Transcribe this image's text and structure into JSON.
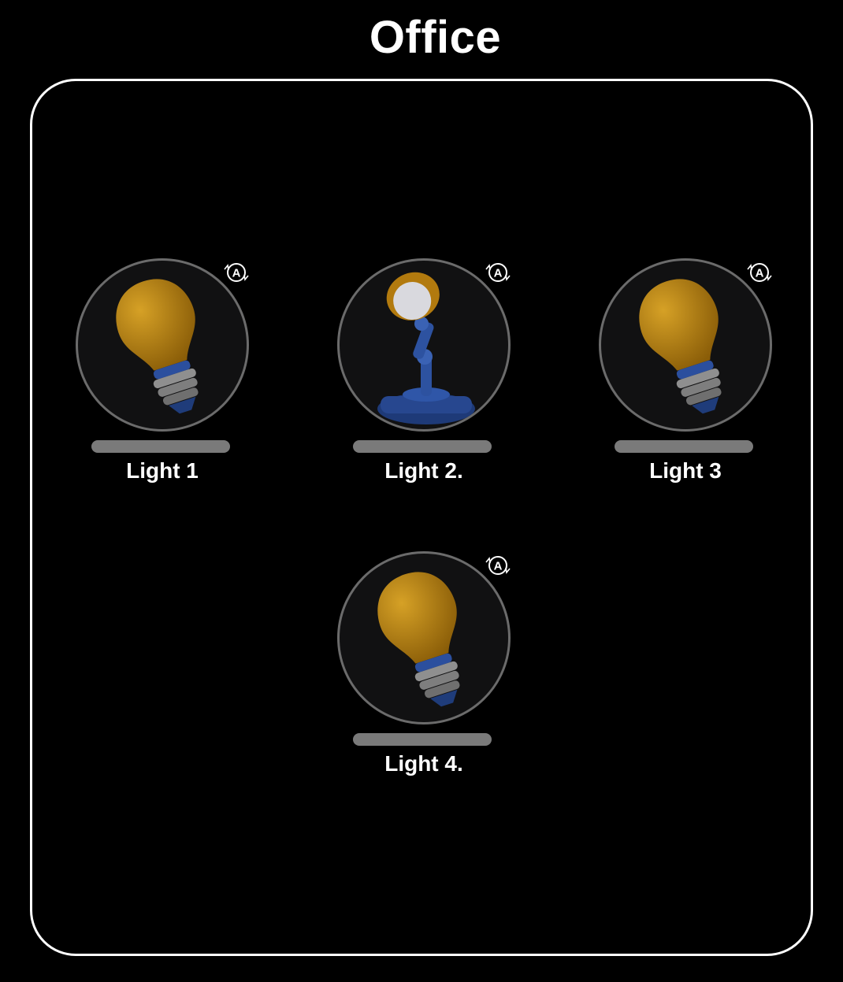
{
  "room": {
    "title": "Office"
  },
  "devices": [
    {
      "name": "Light 1",
      "icon": "lightbulb-icon",
      "mode_icon": "auto-mode-icon",
      "mode_letter": "A"
    },
    {
      "name": "Light 2.",
      "icon": "desk-lamp-icon",
      "mode_icon": "auto-mode-icon",
      "mode_letter": "A"
    },
    {
      "name": "Light 3",
      "icon": "lightbulb-icon",
      "mode_icon": "auto-mode-icon",
      "mode_letter": "A"
    },
    {
      "name": "Light 4.",
      "icon": "lightbulb-icon",
      "mode_icon": "auto-mode-icon",
      "mode_letter": "A"
    }
  ],
  "colors": {
    "background": "#000000",
    "bulb": "#c08a14",
    "base": "#2a4fa0",
    "ring": "#6b6b6b",
    "bar": "#7a7a7a"
  }
}
